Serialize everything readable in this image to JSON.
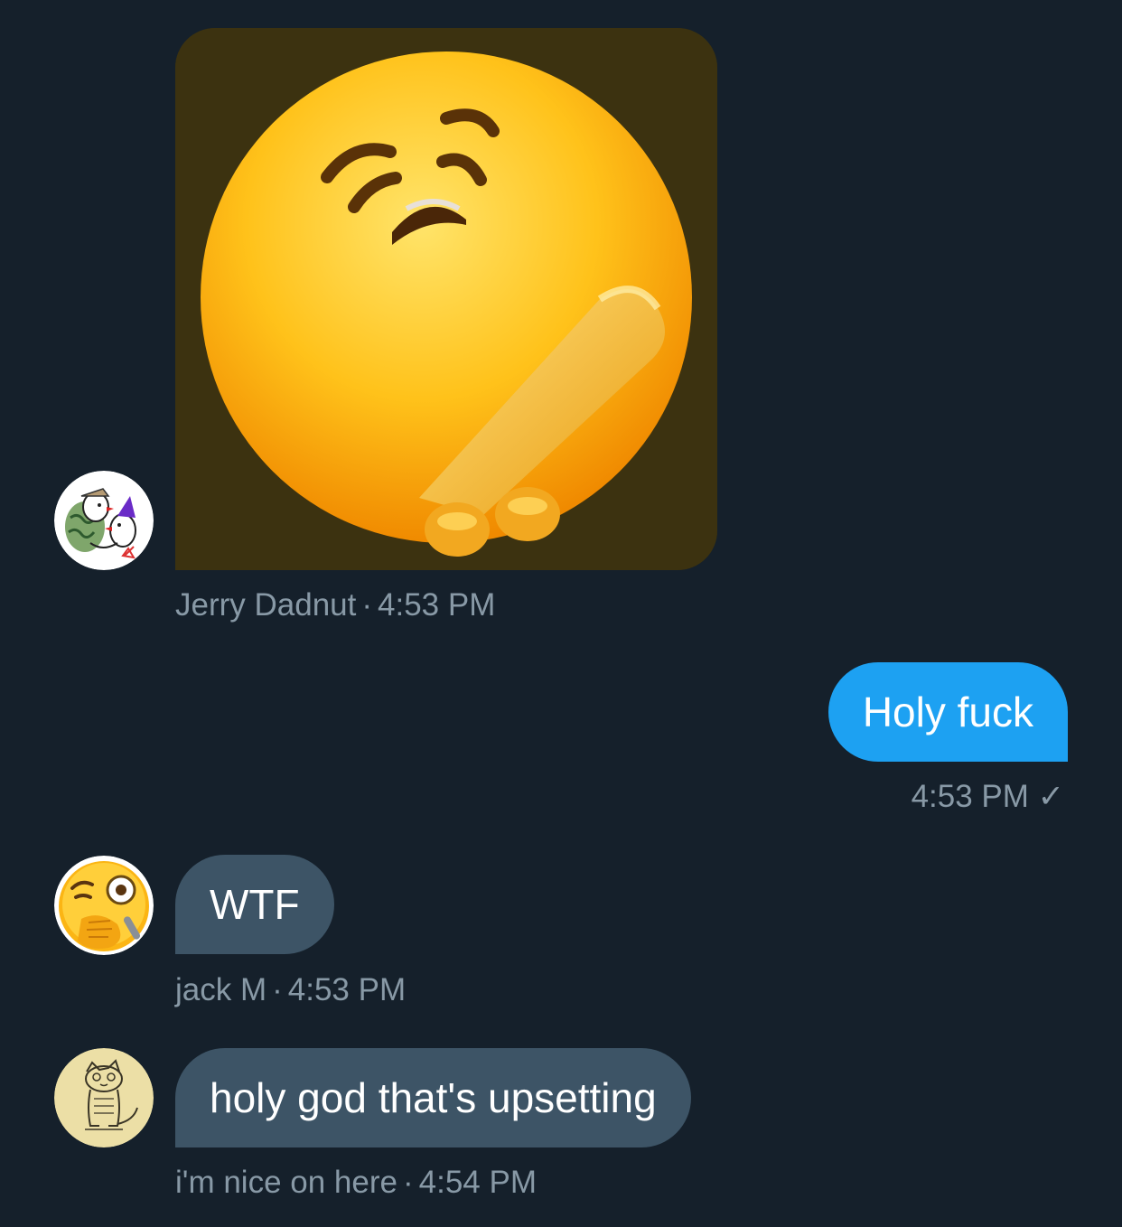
{
  "conversation": {
    "messages": [
      {
        "sender": "Jerry Dadnut",
        "time": "4:53 PM",
        "avatar_icon": "birds-avatar-icon",
        "media": "sticker-emoji-face-icon"
      },
      {
        "outgoing": true,
        "text": "Holy fuck",
        "time": "4:53 PM",
        "status_icon": "checkmark-icon",
        "status_glyph": "✓"
      },
      {
        "sender": "jack M",
        "time": "4:53 PM",
        "avatar_icon": "monocle-face-emoji-avatar-icon",
        "text": "WTF"
      },
      {
        "sender": "i'm nice on here",
        "time": "4:54 PM",
        "avatar_icon": "cat-sketch-avatar-icon",
        "text": "holy god that's upsetting"
      }
    ],
    "meta_separator": "·"
  },
  "colors": {
    "background": "#15202b",
    "incoming_bubble": "#3d5466",
    "outgoing_bubble": "#1da1f2",
    "meta_text": "#8899a6"
  }
}
